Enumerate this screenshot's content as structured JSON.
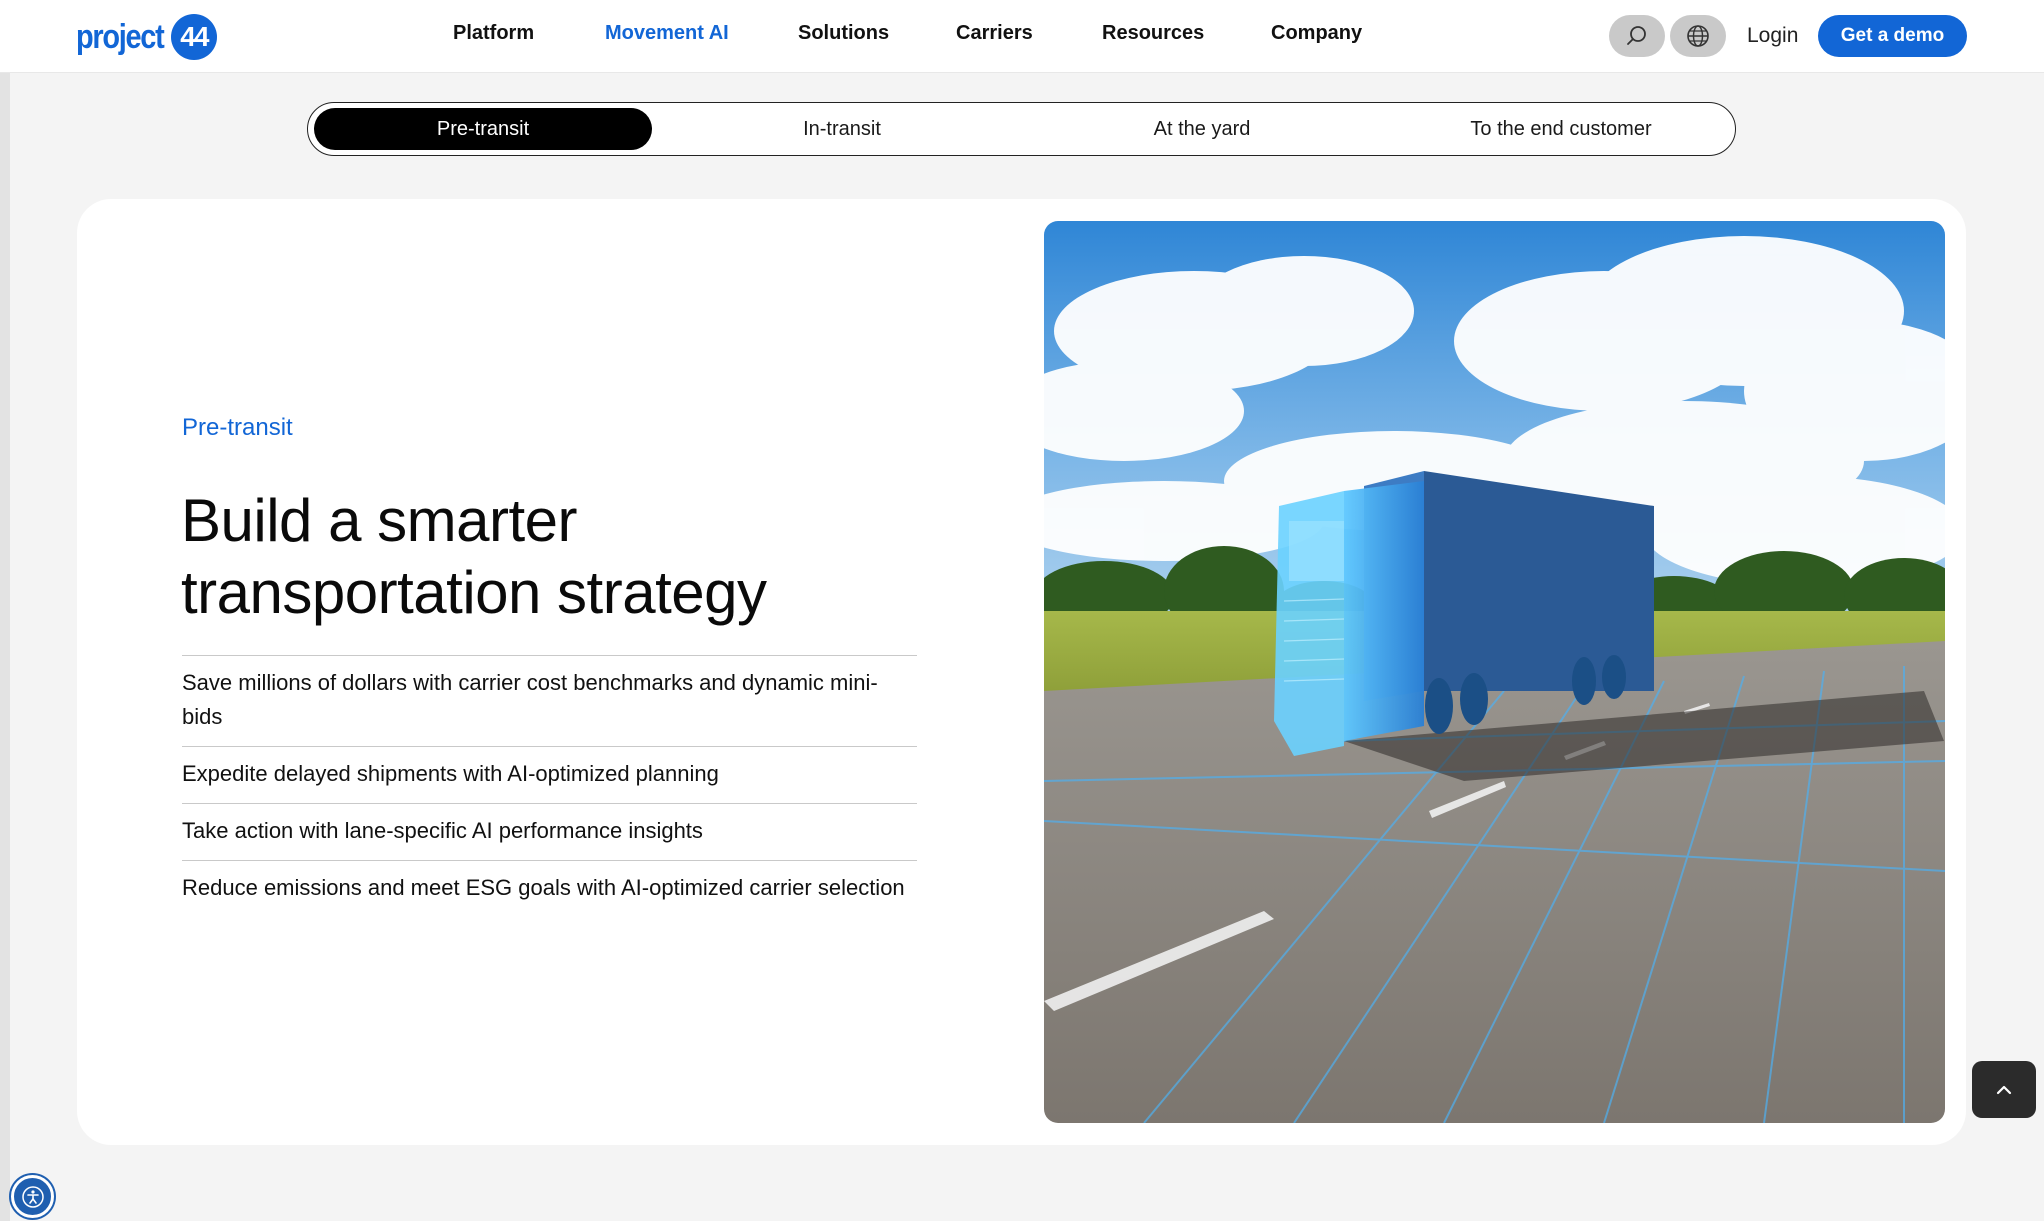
{
  "brand": {
    "logo_text": "project",
    "logo_badge": "44",
    "accent": "#1266d6"
  },
  "nav": {
    "items": [
      {
        "label": "Platform",
        "active": false
      },
      {
        "label": "Movement AI",
        "active": true
      },
      {
        "label": "Solutions",
        "active": false
      },
      {
        "label": "Carriers",
        "active": false
      },
      {
        "label": "Resources",
        "active": false
      },
      {
        "label": "Company",
        "active": false
      }
    ],
    "search_icon": "search-icon",
    "globe_icon": "globe-icon",
    "login_label": "Login",
    "demo_label": "Get a demo"
  },
  "tabs": [
    {
      "label": "Pre-transit",
      "active": true
    },
    {
      "label": "In-transit",
      "active": false
    },
    {
      "label": "At the yard",
      "active": false
    },
    {
      "label": "To the end customer",
      "active": false
    }
  ],
  "content": {
    "eyebrow": "Pre-transit",
    "headline": "Build a smarter transportation strategy",
    "bullets": [
      "Save millions of dollars with carrier cost benchmarks and dynamic mini-bids",
      "Expedite delayed shipments with AI-optimized planning",
      "Take action with lane-specific AI performance insights",
      "Reduce emissions and meet ESG goals with AI-optimized carrier selection"
    ]
  },
  "floating": {
    "scroll_top_icon": "chevron-up-icon",
    "accessibility_icon": "accessibility-icon"
  }
}
